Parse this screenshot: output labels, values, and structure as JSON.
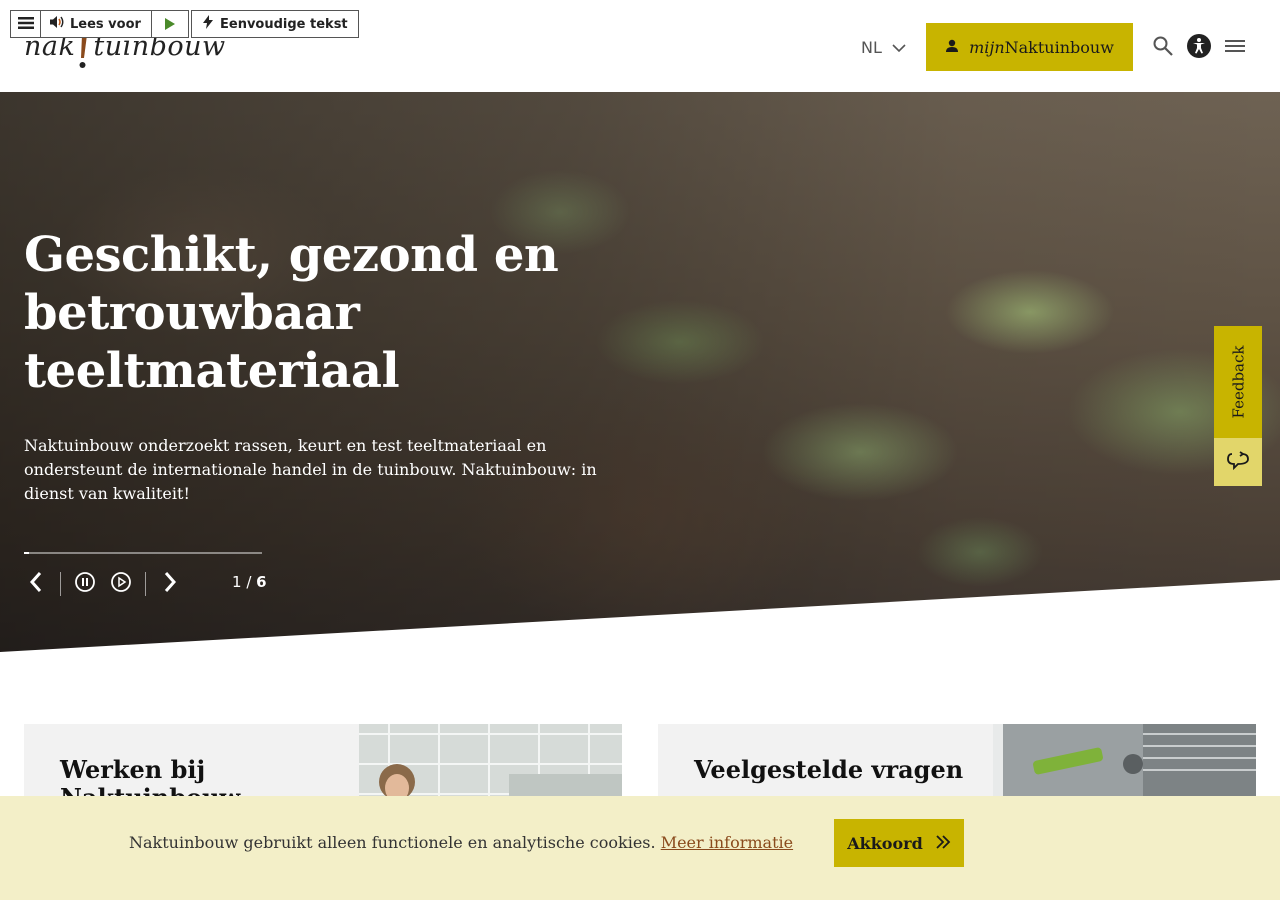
{
  "header": {
    "logo_left": "nak",
    "logo_right": "tuinbouw",
    "read_aloud_label": "Lees voor",
    "simple_text_label": "Eenvoudige tekst",
    "language": "NL",
    "account_prefix": "mijn",
    "account_suffix": "Naktuinbouw",
    "icons": [
      "menu-icon",
      "speaker-icon",
      "play-icon",
      "lightning-icon",
      "chevron-down-icon",
      "user-icon",
      "search-icon",
      "accessibility-icon",
      "hamburger-icon"
    ]
  },
  "hero": {
    "title": "Geschikt, gezond en betrouwbaar teeltmateriaal",
    "lead": "Naktuinbouw onderzoekt rassen, keurt en test teeltmateriaal en ondersteunt de internationale handel in de tuinbouw. Naktuinbouw: in dienst van kwaliteit!",
    "slide_current": "1",
    "slide_total": "6",
    "progress": 0.02
  },
  "feedback": {
    "label": "Feedback"
  },
  "cards": [
    {
      "title": "Werken bij Naktuinbouw"
    },
    {
      "title": "Veelgestelde vragen"
    }
  ],
  "cookie": {
    "text": "Naktuinbouw gebruikt alleen functionele en analytische cookies.",
    "link": "Meer informatie",
    "button": "Akkoord"
  },
  "colors": {
    "brand_yellow": "#c8b400",
    "cookie_bg": "#f3efc8",
    "link_brown": "#8a4a1c"
  }
}
